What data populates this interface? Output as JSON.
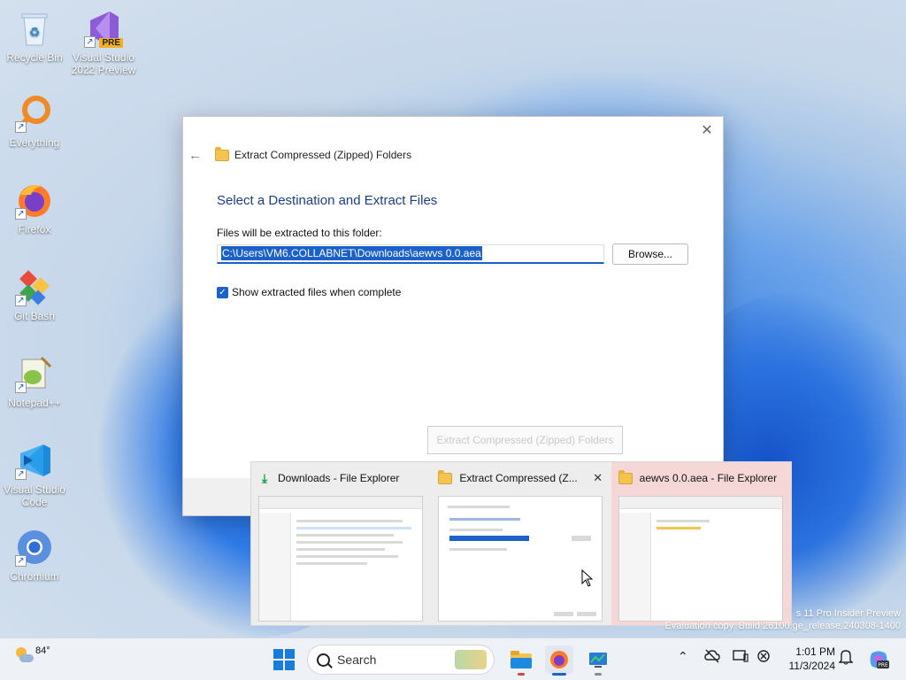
{
  "desktop": {
    "icons": [
      {
        "label": "Recycle Bin",
        "icon": "recycle-bin-icon"
      },
      {
        "label": "Visual Studio 2022 Preview",
        "line1": "Visual Studio",
        "line2": "2022 Preview",
        "badge": "PRE",
        "icon": "visual-studio-preview-icon"
      },
      {
        "label": "Everything",
        "icon": "everything-search-icon"
      },
      {
        "label": "Firefox",
        "icon": "firefox-icon"
      },
      {
        "label": "Git Bash",
        "icon": "git-bash-icon"
      },
      {
        "label": "Notepad++",
        "icon": "notepad-plus-plus-icon"
      },
      {
        "label": "Visual Studio Code",
        "line1": "Visual Studio",
        "line2": "Code",
        "icon": "vscode-icon"
      },
      {
        "label": "Chromium",
        "icon": "chromium-icon"
      }
    ],
    "watermark_line1": "s 11 Pro Insider Preview",
    "watermark_line2": "Evaluation copy. Build 26100.ge_release.240308-1400"
  },
  "dialog": {
    "window_title": "Extract Compressed (Zipped) Folders",
    "heading": "Select a Destination and Extract Files",
    "files_label": "Files will be extracted to this folder:",
    "path_value": "C:\\Users\\VM6.COLLABNET\\Downloads\\aewvs 0.0.aea",
    "browse_label": "Browse...",
    "show_files_label": "Show extracted files when complete",
    "show_files_checked": true,
    "extract_label": "Extract Compressed (Zipped) Folders"
  },
  "thumbnails": [
    {
      "title": "Downloads - File Explorer",
      "icon": "download-icon"
    },
    {
      "title": "Extract Compressed (Z...",
      "icon": "zip-folder-icon",
      "close": "✕"
    },
    {
      "title": "aewvs 0.0.aea - File Explorer",
      "icon": "folder-icon"
    }
  ],
  "taskbar": {
    "weather_temp": "84°",
    "search_placeholder": "Search",
    "time": "1:01 PM",
    "date": "11/3/2024"
  },
  "colors": {
    "accent": "#1c61c9",
    "heading": "#1b3e8a",
    "hover_thumb": "#f6d7d7"
  }
}
